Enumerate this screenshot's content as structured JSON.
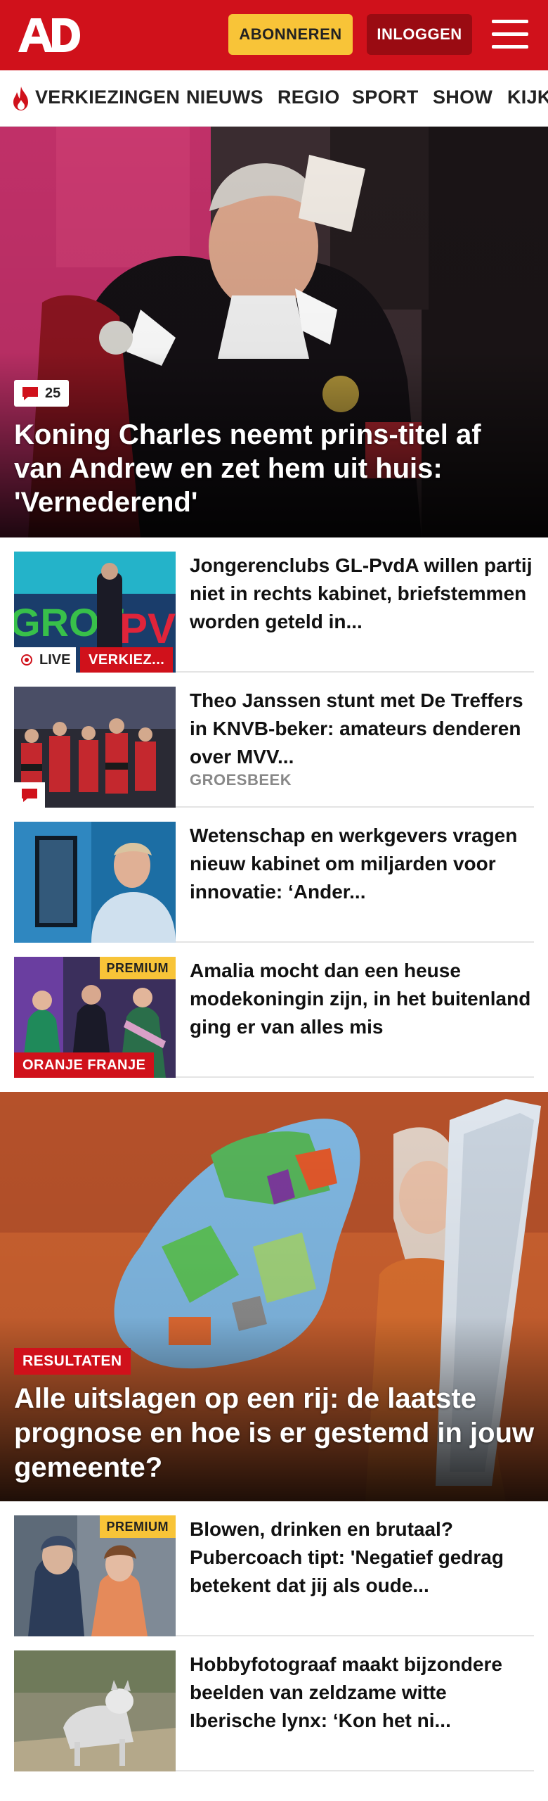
{
  "header": {
    "logo_text": "AD",
    "subscribe_label": "ABONNEREN",
    "login_label": "INLOGGEN",
    "brand_color": "#d0111b",
    "subscribe_color": "#f8c438"
  },
  "nav": {
    "items": [
      {
        "label": "VERKIEZINGEN",
        "icon": "flame-icon"
      },
      {
        "label": "NIEUWS"
      },
      {
        "label": "REGIO"
      },
      {
        "label": "SPORT"
      },
      {
        "label": "SHOW"
      },
      {
        "label": "KIJK"
      }
    ]
  },
  "hero": {
    "comment_count": "25",
    "title": "Koning Charles neemt prins-titel af van Andrew en zet hem uit huis: 'Vernederend'"
  },
  "articles": [
    {
      "title": "Jongerenclubs GL-PvdA willen partij niet in rechts kabinet, briefstemmen worden geteld in...",
      "live_label": "LIVE",
      "tag": "VERKIEZ..."
    },
    {
      "title": "Theo Janssen stunt met De Treffers in KNVB-beker: amateurs denderen over MVV...",
      "location": "GROESBEEK"
    },
    {
      "title": "Wetenschap en werkgevers vragen nieuw kabinet om miljarden voor innovatie: ‘Ander..."
    },
    {
      "title": "Amalia mocht dan een heuse modekoningin zijn, in het buitenland ging er van alles mis",
      "premium": "PREMIUM",
      "tag": "ORANJE FRANJE"
    }
  ],
  "feature": {
    "tag": "RESULTATEN",
    "title": "Alle uitslagen op een rij: de laatste prognose en hoe is er gestemd in jouw gemeente?"
  },
  "articles2": [
    {
      "title": "Blowen, drinken en brutaal? Pubercoach tipt: 'Negatief gedrag betekent dat jij als oude...",
      "premium": "PREMIUM"
    },
    {
      "title": "Hobbyfotograaf maakt bijzondere beelden van zeldzame witte Iberische lynx: ‘Kon het ni..."
    }
  ]
}
